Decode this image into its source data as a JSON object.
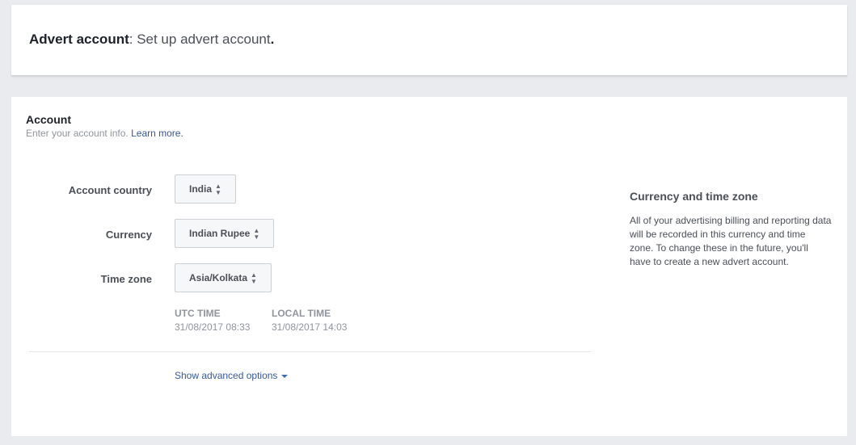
{
  "header": {
    "title_bold": "Advert account",
    "title_rest": ": Set up advert account",
    "title_period": "."
  },
  "account": {
    "title": "Account",
    "subtitle": "Enter your account info.",
    "learn_more": "Learn more."
  },
  "fields": {
    "country_label": "Account country",
    "country_value": "India",
    "currency_label": "Currency",
    "currency_value": "Indian Rupee",
    "timezone_label": "Time zone",
    "timezone_value": "Asia/Kolkata"
  },
  "times": {
    "utc_label": "UTC TIME",
    "utc_value": "31/08/2017 08:33",
    "local_label": "LOCAL TIME",
    "local_value": "31/08/2017 14:03"
  },
  "advanced": {
    "label": "Show advanced options"
  },
  "side": {
    "title": "Currency and time zone",
    "body": "All of your advertising billing and reporting data will be recorded in this currency and time zone. To change these in the future, you'll have to create a new advert account."
  },
  "icons": {
    "select_arrows": "sort-arrows-icon",
    "dropdown_caret": "caret-down-icon"
  },
  "colors": {
    "link": "#365899",
    "background": "#e9ebee",
    "card": "#ffffff"
  }
}
